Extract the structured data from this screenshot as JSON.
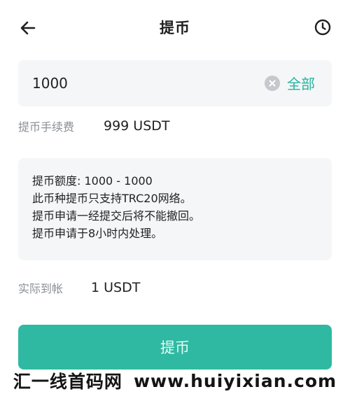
{
  "header": {
    "title": "提币",
    "back_icon": "arrow-left-icon",
    "history_icon": "clock-icon"
  },
  "amount": {
    "value": "1000",
    "all_label": "全部",
    "clear_icon": "clear-circle-icon"
  },
  "fee": {
    "label": "提币手续费",
    "value": "999 USDT"
  },
  "notice": {
    "lines": [
      "提币额度: 1000 - 1000",
      "此币种提币只支持TRC20网络。",
      "提币申请一经提交后将不能撤回。",
      "提币申请于8小时内处理。"
    ]
  },
  "receive": {
    "label": "实际到帐",
    "value": "1 USDT"
  },
  "submit": {
    "label": "提币"
  },
  "watermark": {
    "cn": "汇一线首码网",
    "url": "www.huiyixian.com"
  },
  "colors": {
    "accent": "#2fb9a2",
    "accent_text": "#22b5a0",
    "panel_bg": "#f4f6f8",
    "muted_text": "#8a8f95"
  }
}
